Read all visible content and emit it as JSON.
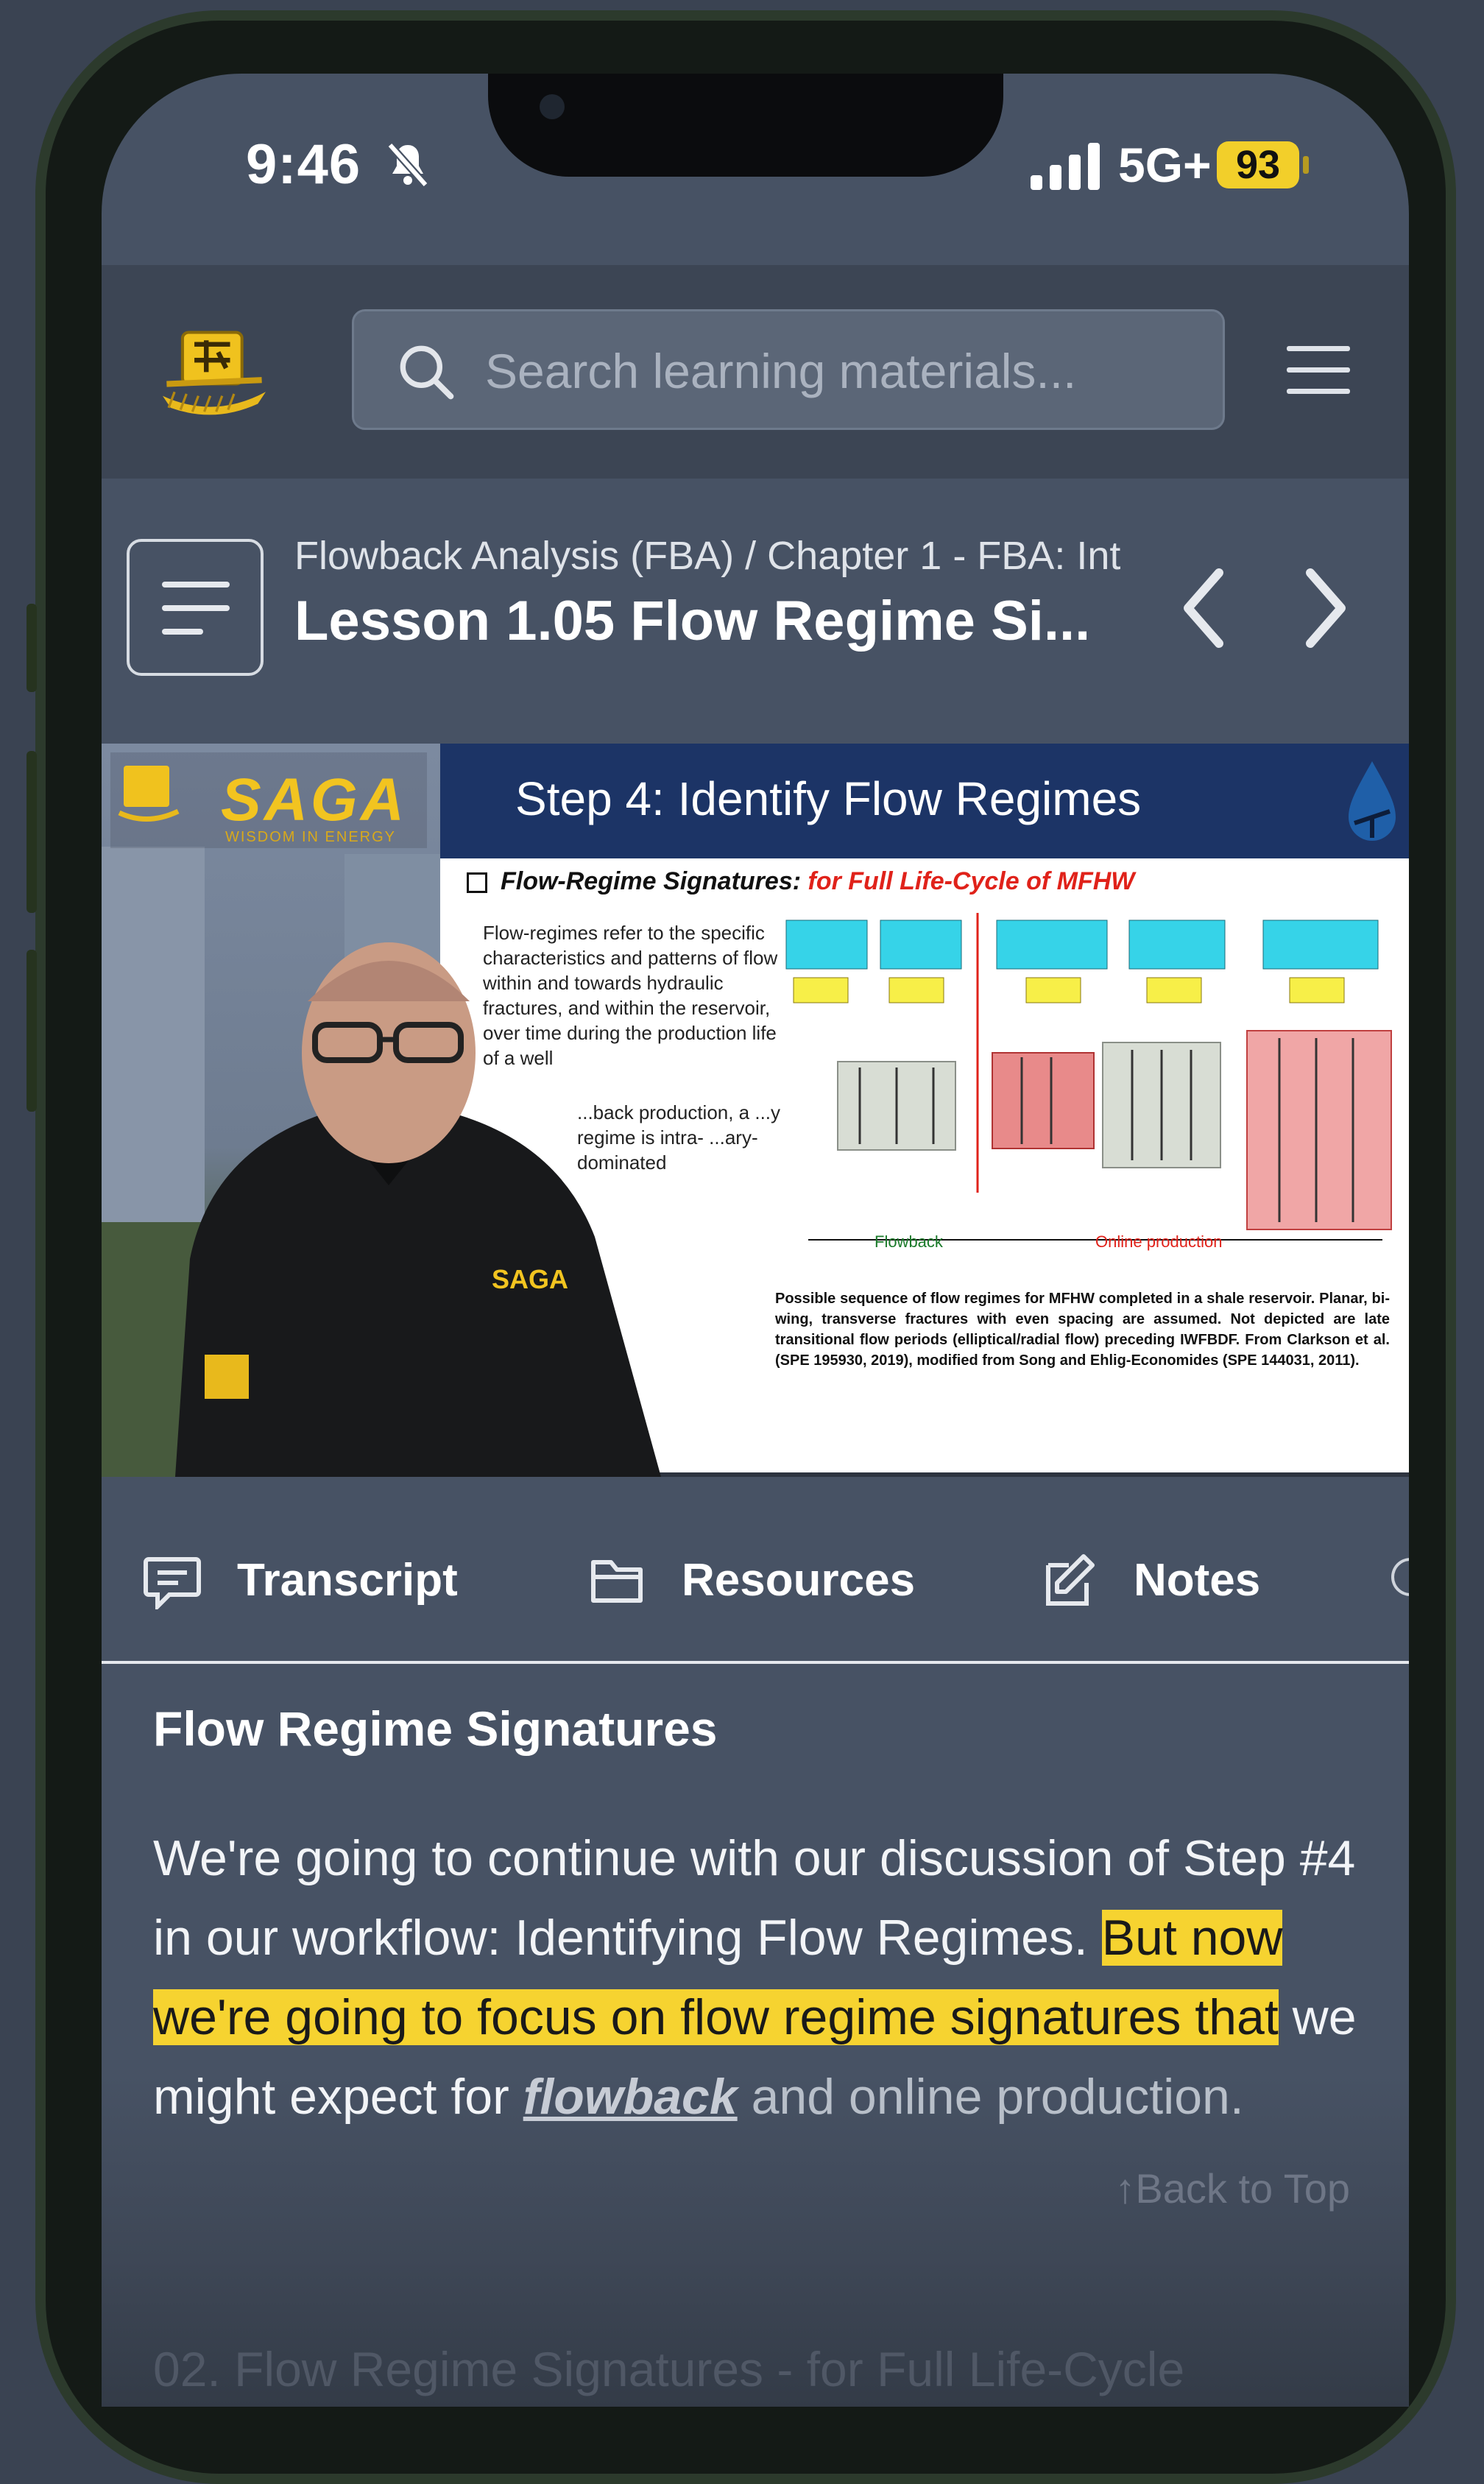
{
  "status_bar": {
    "time": "9:46",
    "network": "5G+",
    "battery": "93"
  },
  "header": {
    "search_placeholder": "Search learning materials..."
  },
  "lesson": {
    "breadcrumb": "Flowback Analysis (FBA) / Chapter 1 - FBA: Int",
    "title": "Lesson 1.05 Flow Regime Si..."
  },
  "video": {
    "brand": "SAGA",
    "brand_tagline": "WISDOM IN ENERGY",
    "slide_title": "Step 4: Identify Flow Regimes",
    "slide_subtitle_prefix": "Flow-Regime Signatures:",
    "slide_subtitle_highlight": "for Full Life-Cycle of MFHW",
    "slide_bullet_1": "Flow-regimes refer to the specific characteristics and patterns of flow within and towards hydraulic fractures, and within the reservoir, over time during the production life of a well",
    "slide_bullet_2": "...back production, a ...y regime is intra- ...ary-dominated",
    "flowback_label": "Flowback",
    "online_label": "Online production",
    "caption": "Possible sequence of flow regimes for MFHW completed in a shale reservoir. Planar, bi-wing, transverse fractures with even spacing are assumed. Not depicted are late transitional flow periods (elliptical/radial flow) preceding IWFBDF. From Clarkson et al. (SPE 195930, 2019), modified from Song and Ehlig-Economides (SPE 144031, 2011)."
  },
  "tabs": [
    {
      "label": "Transcript"
    },
    {
      "label": "Resources"
    },
    {
      "label": "Notes"
    }
  ],
  "content": {
    "section_heading": "Flow Regime Signatures",
    "para_part1": "We're going to continue with our discussion of Step #4 in our workflow: Identifying Flow Regimes.",
    "para_highlight": "But now we're going to focus on flow regime signatures that",
    "para_part2": "we might expect for",
    "para_link": "flowback",
    "para_part3": "and online production.",
    "back_to_top": "Back to Top",
    "next_section": "02. Flow Regime Signatures - for Full Life-Cycle"
  },
  "colors": {
    "highlight": "#f6d330",
    "background": "#475264",
    "slide_header": "#1c3466"
  }
}
